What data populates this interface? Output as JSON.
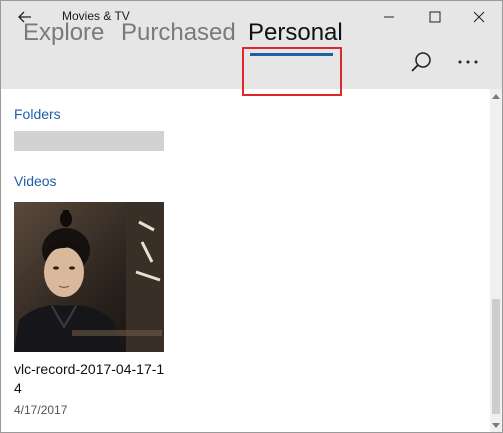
{
  "window": {
    "title": "Movies & TV"
  },
  "titlebar_icons": {
    "back": "back-arrow-icon",
    "minimize": "minimize-icon",
    "maximize": "maximize-icon",
    "close": "close-icon"
  },
  "pivot": {
    "tabs": [
      {
        "label": "Explore",
        "selected": false
      },
      {
        "label": "Purchased",
        "selected": false
      },
      {
        "label": "Personal",
        "selected": true
      }
    ],
    "accent_color": "#1f5fa8",
    "highlight_color": "#e0252b"
  },
  "header_icons": {
    "search": "search-icon",
    "more": "more-options-icon"
  },
  "sections": {
    "folders": {
      "title": "Folders"
    },
    "videos": {
      "title": "Videos"
    }
  },
  "videos": [
    {
      "name": "vlc-record-2017-04-17-14",
      "date": "4/17/2017"
    }
  ]
}
